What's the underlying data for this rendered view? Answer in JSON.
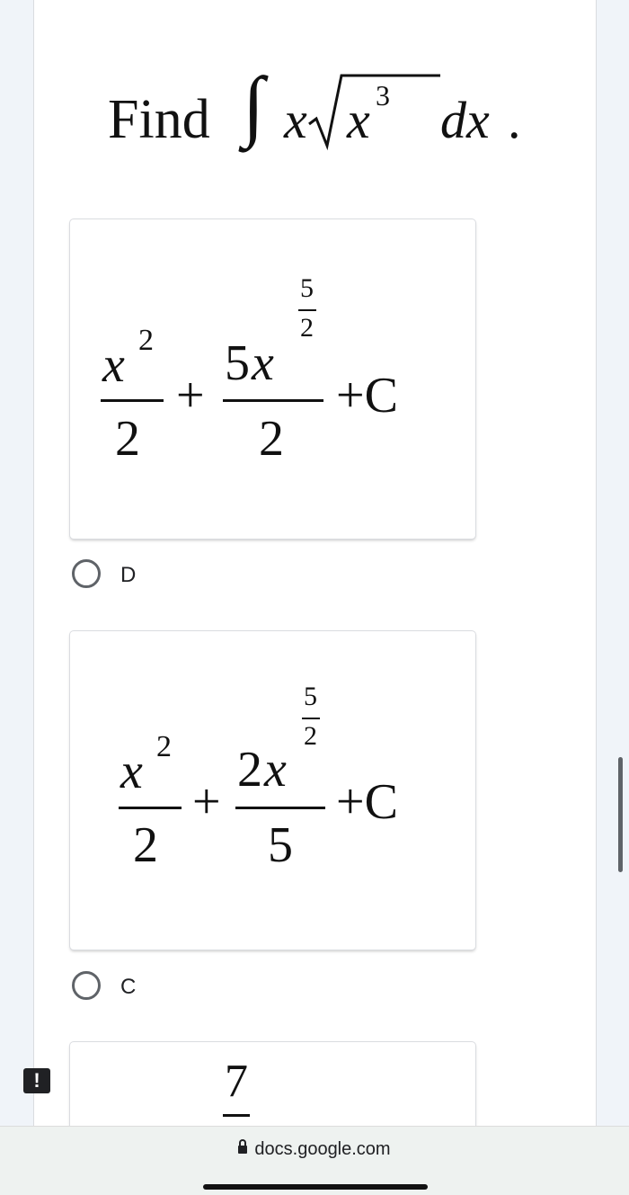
{
  "question": {
    "prefix": "Find",
    "integral_symbol": "∫",
    "var": "x",
    "radicand": "x",
    "radicand_exp": "3",
    "differential": "dx",
    "period": "."
  },
  "options": [
    {
      "label": "D",
      "t1_num": "x",
      "t1_exp": "2",
      "t1_den": "2",
      "plus": "+",
      "t2_coef": "5",
      "t2_var": "x",
      "t2_exp_num": "5",
      "t2_exp_den": "2",
      "t2_den": "2",
      "const": "+C"
    },
    {
      "label": "C",
      "t1_num": "x",
      "t1_exp": "2",
      "t1_den": "2",
      "plus": "+",
      "t2_coef": "2",
      "t2_var": "x",
      "t2_exp_num": "5",
      "t2_exp_den": "2",
      "t2_den": "5",
      "const": "+C"
    }
  ],
  "partial_option": {
    "top_value": "7"
  },
  "alert_icon": "!",
  "browser": {
    "url": "docs.google.com"
  },
  "icons": [
    "alert-icon",
    "lock-icon",
    "radio-icon"
  ],
  "colors": {
    "background": "#f0f4f9",
    "card": "#ffffff",
    "radio": "#5f6368"
  }
}
